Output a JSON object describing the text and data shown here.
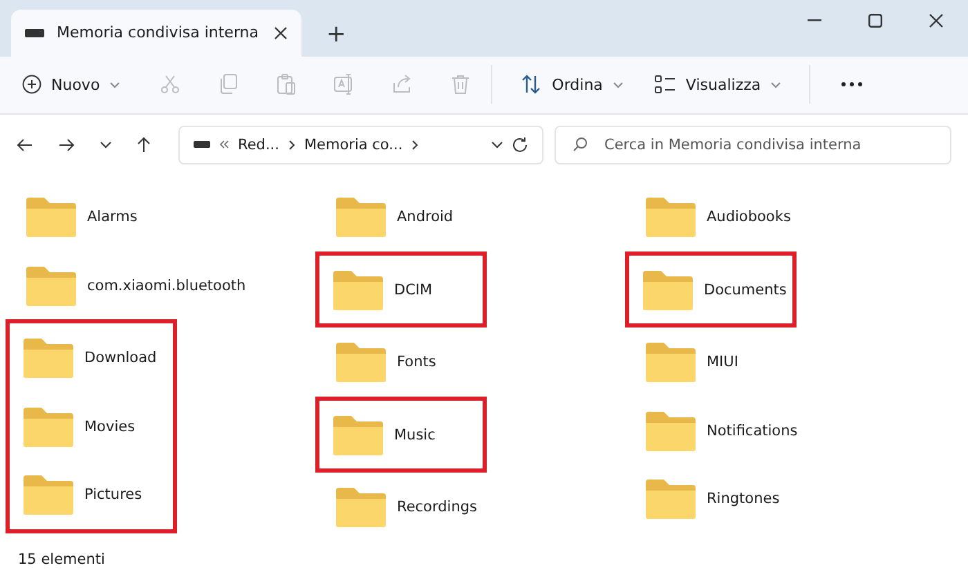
{
  "window": {
    "tab_title": "Memoria condivisa interna",
    "new_tab": "+"
  },
  "toolbar": {
    "new_label": "Nuovo",
    "actions": [
      {
        "kind": "cut",
        "disabled": true
      },
      {
        "kind": "copy",
        "disabled": true
      },
      {
        "kind": "paste",
        "disabled": true
      },
      {
        "kind": "rename",
        "disabled": true
      },
      {
        "kind": "share",
        "disabled": true
      },
      {
        "kind": "delete",
        "disabled": true
      }
    ],
    "sort_label": "Ordina",
    "view_label": "Visualizza"
  },
  "address": {
    "crumbs": [
      "Red...",
      "Memoria co..."
    ],
    "search_placeholder": "Cerca in Memoria condivisa interna"
  },
  "folders": [
    {
      "name": "Alarms",
      "highlighted": false
    },
    {
      "name": "Android",
      "highlighted": false
    },
    {
      "name": "Audiobooks",
      "highlighted": false
    },
    {
      "name": "com.xiaomi.bluetooth",
      "highlighted": false
    },
    {
      "name": "DCIM",
      "highlighted": true
    },
    {
      "name": "Documents",
      "highlighted": true
    },
    {
      "name": "Download",
      "highlighted": true
    },
    {
      "name": "Fonts",
      "highlighted": false
    },
    {
      "name": "MIUI",
      "highlighted": false
    },
    {
      "name": "Movies",
      "highlighted": true
    },
    {
      "name": "Music",
      "highlighted": true
    },
    {
      "name": "Notifications",
      "highlighted": false
    },
    {
      "name": "Pictures",
      "highlighted": true
    },
    {
      "name": "Recordings",
      "highlighted": false
    },
    {
      "name": "Ringtones",
      "highlighted": false
    }
  ],
  "status_bar": "15 elementi"
}
